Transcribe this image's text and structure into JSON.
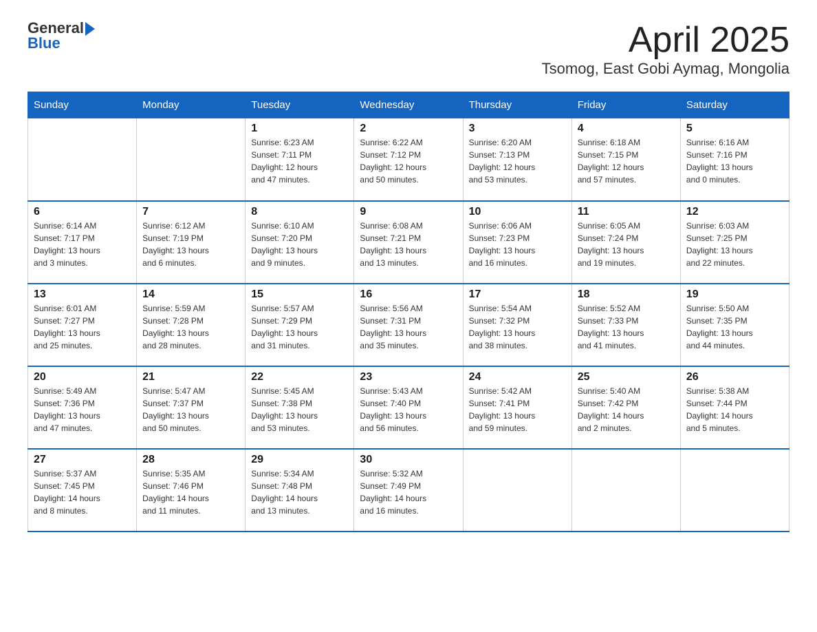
{
  "header": {
    "logo_text_general": "General",
    "logo_text_blue": "Blue",
    "title": "April 2025",
    "subtitle": "Tsomog, East Gobi Aymag, Mongolia"
  },
  "calendar": {
    "days_of_week": [
      "Sunday",
      "Monday",
      "Tuesday",
      "Wednesday",
      "Thursday",
      "Friday",
      "Saturday"
    ],
    "weeks": [
      [
        {
          "day": "",
          "info": ""
        },
        {
          "day": "",
          "info": ""
        },
        {
          "day": "1",
          "info": "Sunrise: 6:23 AM\nSunset: 7:11 PM\nDaylight: 12 hours\nand 47 minutes."
        },
        {
          "day": "2",
          "info": "Sunrise: 6:22 AM\nSunset: 7:12 PM\nDaylight: 12 hours\nand 50 minutes."
        },
        {
          "day": "3",
          "info": "Sunrise: 6:20 AM\nSunset: 7:13 PM\nDaylight: 12 hours\nand 53 minutes."
        },
        {
          "day": "4",
          "info": "Sunrise: 6:18 AM\nSunset: 7:15 PM\nDaylight: 12 hours\nand 57 minutes."
        },
        {
          "day": "5",
          "info": "Sunrise: 6:16 AM\nSunset: 7:16 PM\nDaylight: 13 hours\nand 0 minutes."
        }
      ],
      [
        {
          "day": "6",
          "info": "Sunrise: 6:14 AM\nSunset: 7:17 PM\nDaylight: 13 hours\nand 3 minutes."
        },
        {
          "day": "7",
          "info": "Sunrise: 6:12 AM\nSunset: 7:19 PM\nDaylight: 13 hours\nand 6 minutes."
        },
        {
          "day": "8",
          "info": "Sunrise: 6:10 AM\nSunset: 7:20 PM\nDaylight: 13 hours\nand 9 minutes."
        },
        {
          "day": "9",
          "info": "Sunrise: 6:08 AM\nSunset: 7:21 PM\nDaylight: 13 hours\nand 13 minutes."
        },
        {
          "day": "10",
          "info": "Sunrise: 6:06 AM\nSunset: 7:23 PM\nDaylight: 13 hours\nand 16 minutes."
        },
        {
          "day": "11",
          "info": "Sunrise: 6:05 AM\nSunset: 7:24 PM\nDaylight: 13 hours\nand 19 minutes."
        },
        {
          "day": "12",
          "info": "Sunrise: 6:03 AM\nSunset: 7:25 PM\nDaylight: 13 hours\nand 22 minutes."
        }
      ],
      [
        {
          "day": "13",
          "info": "Sunrise: 6:01 AM\nSunset: 7:27 PM\nDaylight: 13 hours\nand 25 minutes."
        },
        {
          "day": "14",
          "info": "Sunrise: 5:59 AM\nSunset: 7:28 PM\nDaylight: 13 hours\nand 28 minutes."
        },
        {
          "day": "15",
          "info": "Sunrise: 5:57 AM\nSunset: 7:29 PM\nDaylight: 13 hours\nand 31 minutes."
        },
        {
          "day": "16",
          "info": "Sunrise: 5:56 AM\nSunset: 7:31 PM\nDaylight: 13 hours\nand 35 minutes."
        },
        {
          "day": "17",
          "info": "Sunrise: 5:54 AM\nSunset: 7:32 PM\nDaylight: 13 hours\nand 38 minutes."
        },
        {
          "day": "18",
          "info": "Sunrise: 5:52 AM\nSunset: 7:33 PM\nDaylight: 13 hours\nand 41 minutes."
        },
        {
          "day": "19",
          "info": "Sunrise: 5:50 AM\nSunset: 7:35 PM\nDaylight: 13 hours\nand 44 minutes."
        }
      ],
      [
        {
          "day": "20",
          "info": "Sunrise: 5:49 AM\nSunset: 7:36 PM\nDaylight: 13 hours\nand 47 minutes."
        },
        {
          "day": "21",
          "info": "Sunrise: 5:47 AM\nSunset: 7:37 PM\nDaylight: 13 hours\nand 50 minutes."
        },
        {
          "day": "22",
          "info": "Sunrise: 5:45 AM\nSunset: 7:38 PM\nDaylight: 13 hours\nand 53 minutes."
        },
        {
          "day": "23",
          "info": "Sunrise: 5:43 AM\nSunset: 7:40 PM\nDaylight: 13 hours\nand 56 minutes."
        },
        {
          "day": "24",
          "info": "Sunrise: 5:42 AM\nSunset: 7:41 PM\nDaylight: 13 hours\nand 59 minutes."
        },
        {
          "day": "25",
          "info": "Sunrise: 5:40 AM\nSunset: 7:42 PM\nDaylight: 14 hours\nand 2 minutes."
        },
        {
          "day": "26",
          "info": "Sunrise: 5:38 AM\nSunset: 7:44 PM\nDaylight: 14 hours\nand 5 minutes."
        }
      ],
      [
        {
          "day": "27",
          "info": "Sunrise: 5:37 AM\nSunset: 7:45 PM\nDaylight: 14 hours\nand 8 minutes."
        },
        {
          "day": "28",
          "info": "Sunrise: 5:35 AM\nSunset: 7:46 PM\nDaylight: 14 hours\nand 11 minutes."
        },
        {
          "day": "29",
          "info": "Sunrise: 5:34 AM\nSunset: 7:48 PM\nDaylight: 14 hours\nand 13 minutes."
        },
        {
          "day": "30",
          "info": "Sunrise: 5:32 AM\nSunset: 7:49 PM\nDaylight: 14 hours\nand 16 minutes."
        },
        {
          "day": "",
          "info": ""
        },
        {
          "day": "",
          "info": ""
        },
        {
          "day": "",
          "info": ""
        }
      ]
    ]
  }
}
